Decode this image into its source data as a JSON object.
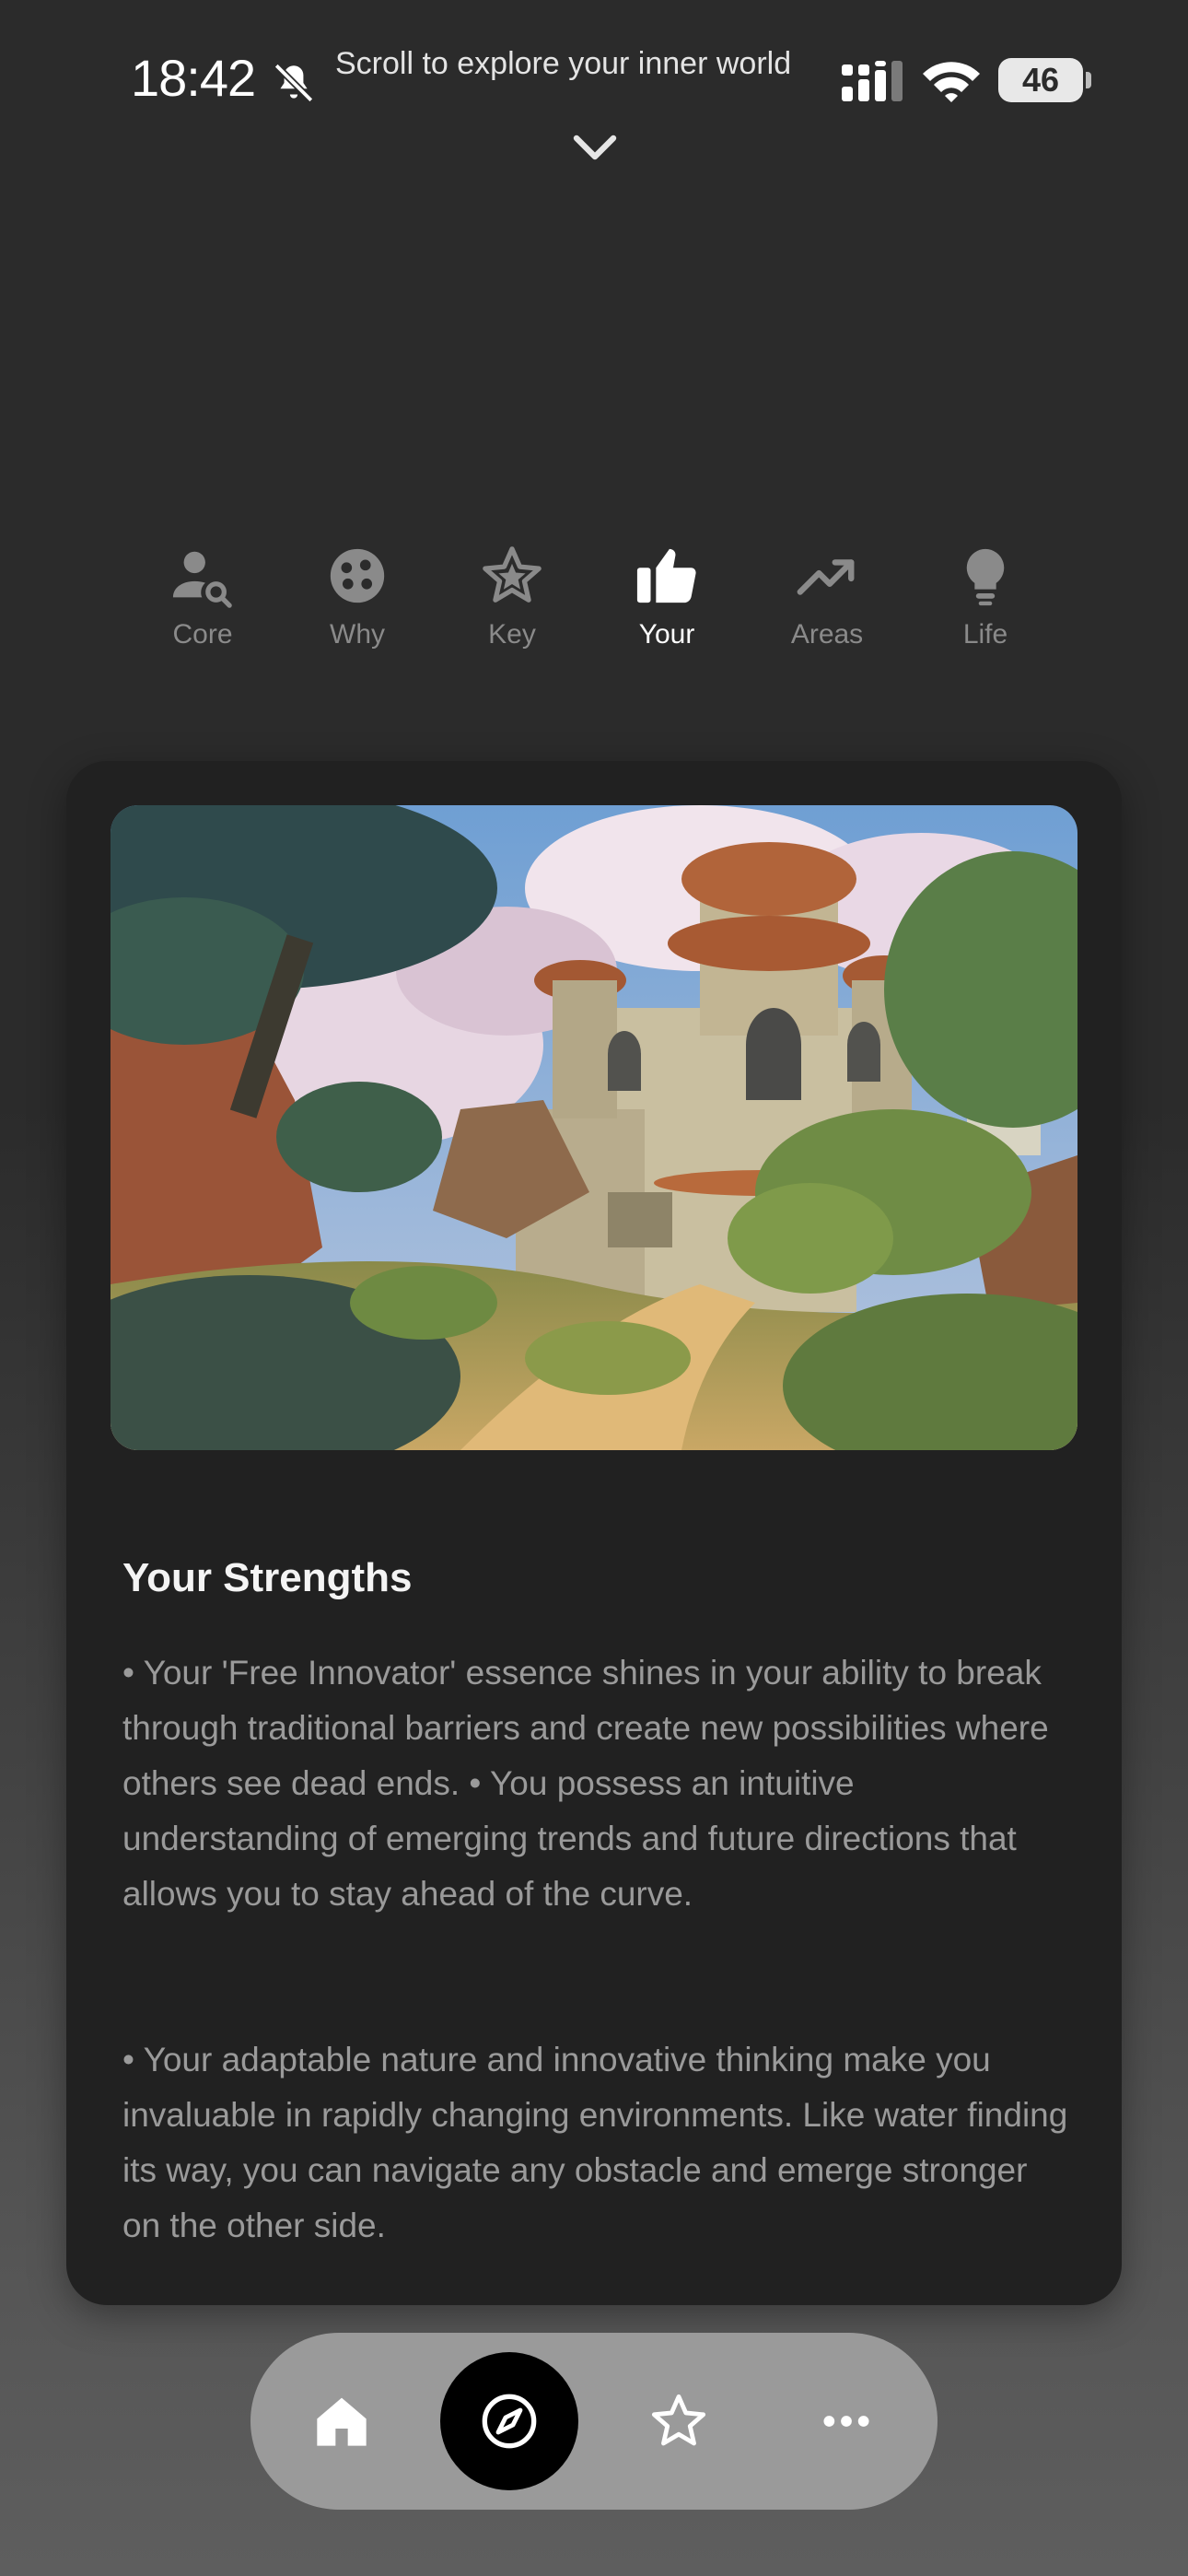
{
  "status_bar": {
    "time": "18:42",
    "battery": "46",
    "battery_level": 0.46,
    "scroll_hint": "Scroll to explore your inner world"
  },
  "tabs": [
    {
      "label": "Core",
      "icon": "person-search-icon",
      "active": false
    },
    {
      "label": "Why",
      "icon": "palette-icon",
      "active": false
    },
    {
      "label": "Key",
      "icon": "star-icon",
      "active": false
    },
    {
      "label": "Your",
      "icon": "thumbs-up-icon",
      "active": true
    },
    {
      "label": "Areas",
      "icon": "trending-up-icon",
      "active": false
    },
    {
      "label": "Life",
      "icon": "lightbulb-icon",
      "active": false
    }
  ],
  "card": {
    "image": "painted-landscape-ancient-temple",
    "title": "Your Strengths",
    "paragraphs": [
      "• Your 'Free Innovator' essence shines in your ability to break through traditional barriers and create new possibilities where others see dead ends. • You possess an intuitive understanding of emerging trends and future directions that allows you to stay ahead of the curve.",
      "• Your adaptable nature and innovative thinking make you invaluable in rapidly changing environments. Like water finding its way, you can navigate any obstacle and emerge stronger on the other side."
    ]
  },
  "bottom_nav": [
    {
      "icon": "home-icon",
      "active": false
    },
    {
      "icon": "compass-icon",
      "active": true
    },
    {
      "icon": "star-outline-icon",
      "active": false
    },
    {
      "icon": "more-icon",
      "active": false
    }
  ],
  "colors": {
    "background": "#2b2b2b",
    "card": "#212121",
    "active_tab": "#ffffff",
    "inactive_tab": "#8a8a8a",
    "nav_pill": "#9a9a9a"
  }
}
